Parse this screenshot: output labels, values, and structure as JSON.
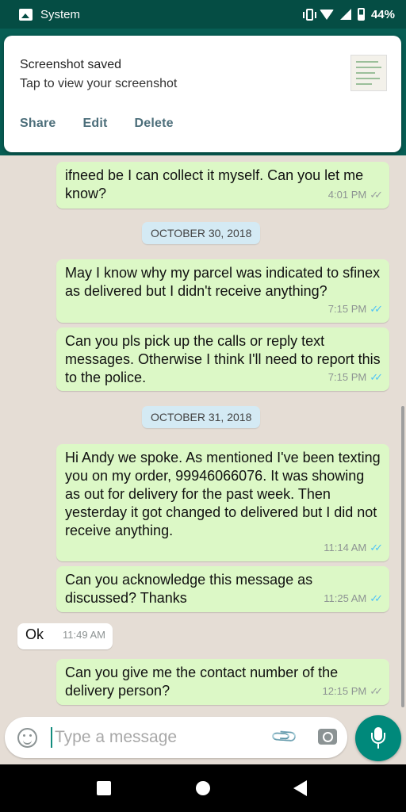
{
  "status_bar": {
    "app_label": "System",
    "battery": "44%",
    "icons": [
      "image-icon",
      "vibrate-icon",
      "wifi-icon",
      "signal-icon",
      "battery-icon"
    ]
  },
  "notification": {
    "title": "Screenshot saved",
    "text": "Tap to view your screenshot",
    "actions": [
      "Share",
      "Edit",
      "Delete"
    ]
  },
  "messages": [
    {
      "dir": "out",
      "text": "ifneed be I can collect it myself. Can you let me know?",
      "time": "4:01 PM",
      "status": "sent"
    },
    {
      "dir": "out",
      "text": "May I know why my parcel was indicated to sfinex as delivered but I didn't receive anything?",
      "time": "7:15 PM",
      "status": "read"
    },
    {
      "dir": "out",
      "text": "Can you pls pick up the calls or reply text messages. Otherwise I think I'll need to report this to the police.",
      "time": "7:15 PM",
      "status": "read"
    },
    {
      "dir": "out",
      "text": "Hi Andy we spoke. As mentioned I've been texting you on my order, 99946066076. It was showing as out for delivery for the past week. Then yesterday it got changed to delivered but I did not receive anything.",
      "time": "11:14 AM",
      "status": "read"
    },
    {
      "dir": "out",
      "text": "Can you acknowledge this message as discussed? Thanks",
      "time": "11:25 AM",
      "status": "read"
    },
    {
      "dir": "in",
      "text": "Ok",
      "time": "11:49 AM"
    },
    {
      "dir": "out",
      "text": "Can you give me the contact number of the delivery person?",
      "time": "12:15 PM",
      "status": "sent"
    }
  ],
  "date_separators": [
    "OCTOBER 30, 2018",
    "OCTOBER 31, 2018"
  ],
  "composer": {
    "placeholder": "Type a message"
  },
  "colors": {
    "header": "#075e54",
    "outgoing_bubble": "#dcf8c6",
    "incoming_bubble": "#ffffff",
    "read_ticks": "#4fc3f7",
    "mic_button": "#00897b",
    "date_pill": "#d4eaf4"
  }
}
